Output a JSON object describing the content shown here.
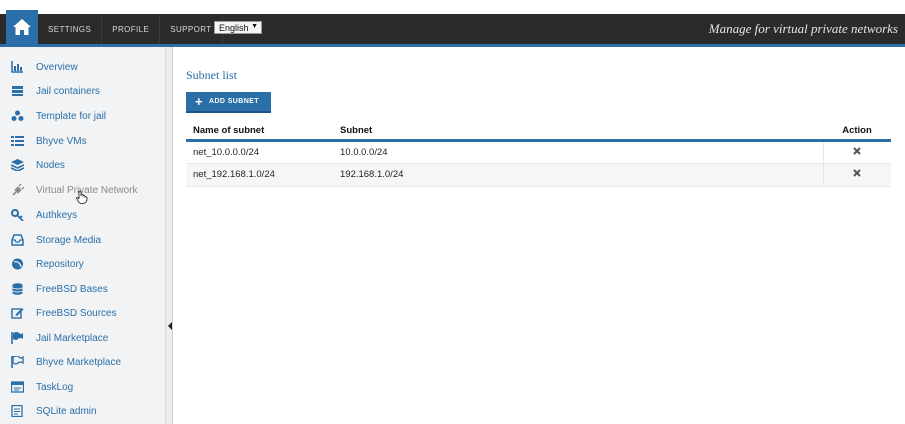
{
  "header": {
    "nav": [
      "SETTINGS",
      "PROFILE",
      "SUPPORT"
    ],
    "language": "English",
    "tagline": "Manage for virtual private networks"
  },
  "sidebar": {
    "items": [
      {
        "label": "Overview",
        "icon": "bar-chart-icon"
      },
      {
        "label": "Jail containers",
        "icon": "server-icon"
      },
      {
        "label": "Template for jail",
        "icon": "cubes-icon"
      },
      {
        "label": "Bhyve VMs",
        "icon": "list-icon"
      },
      {
        "label": "Nodes",
        "icon": "stack-icon"
      },
      {
        "label": "Virtual Private Network",
        "icon": "plug-icon",
        "active": true
      },
      {
        "label": "Authkeys",
        "icon": "key-icon"
      },
      {
        "label": "Storage Media",
        "icon": "inbox-icon"
      },
      {
        "label": "Repository",
        "icon": "globe-icon"
      },
      {
        "label": "FreeBSD Bases",
        "icon": "database-icon"
      },
      {
        "label": "FreeBSD Sources",
        "icon": "edit-icon"
      },
      {
        "label": "Jail Marketplace",
        "icon": "flag-icon"
      },
      {
        "label": "Bhyve Marketplace",
        "icon": "flag-outline-icon"
      },
      {
        "label": "TaskLog",
        "icon": "tasklog-icon"
      },
      {
        "label": "SQLite admin",
        "icon": "sqlite-icon"
      }
    ]
  },
  "main": {
    "title": "Subnet list",
    "add_button": "ADD SUBNET",
    "columns": [
      "Name of subnet",
      "Subnet",
      "Action"
    ],
    "rows": [
      {
        "name": "net_10.0.0.0/24",
        "subnet": "10.0.0.0/24"
      },
      {
        "name": "net_192.168.1.0/24",
        "subnet": "192.168.1.0/24"
      }
    ]
  },
  "colors": {
    "accent": "#2a6fa8",
    "header_bg": "#2b2b2b",
    "sidebar_bg": "#f2f3f5"
  }
}
